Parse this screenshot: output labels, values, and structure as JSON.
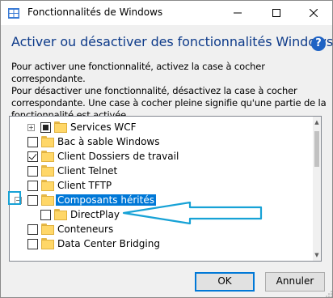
{
  "window": {
    "title": "Fonctionnalités de Windows",
    "minimize_glyph": "—",
    "maximize_glyph": "☐",
    "close_glyph": "✕"
  },
  "header": {
    "heading": "Activer ou désactiver des fonctionnalités Windows",
    "help_glyph": "?"
  },
  "description": "Pour activer une fonctionnalité, activez la case à cocher correspondante.\nPour désactiver une fonctionnalité, désactivez la case à cocher\ncorrespondante. Une case à cocher pleine signifie qu'une partie de la\nfonctionnalité est activée.",
  "tree": {
    "items": [
      {
        "label": "Services WCF",
        "state": "partial",
        "expander": "plus",
        "indent": 1
      },
      {
        "label": "Bac à sable Windows",
        "state": "unchecked",
        "expander": "none",
        "indent": 0
      },
      {
        "label": "Client Dossiers de travail",
        "state": "checked",
        "expander": "none",
        "indent": 0
      },
      {
        "label": "Client Telnet",
        "state": "unchecked",
        "expander": "none",
        "indent": 0
      },
      {
        "label": "Client TFTP",
        "state": "unchecked",
        "expander": "none",
        "indent": 0
      },
      {
        "label": "Composants hérités",
        "state": "unchecked",
        "expander": "minus",
        "indent": 0,
        "selected": true
      },
      {
        "label": "DirectPlay",
        "state": "unchecked",
        "expander": "none",
        "indent": 1
      },
      {
        "label": "Conteneurs",
        "state": "unchecked",
        "expander": "none",
        "indent": 0
      },
      {
        "label": "Data Center Bridging",
        "state": "unchecked",
        "expander": "none",
        "indent": 0
      }
    ]
  },
  "buttons": {
    "ok": "OK",
    "cancel": "Annuler"
  },
  "colors": {
    "heading": "#0e3b8a",
    "selection": "#0078d7",
    "annotation": "#17a2d6",
    "folder": "#ffd768"
  }
}
